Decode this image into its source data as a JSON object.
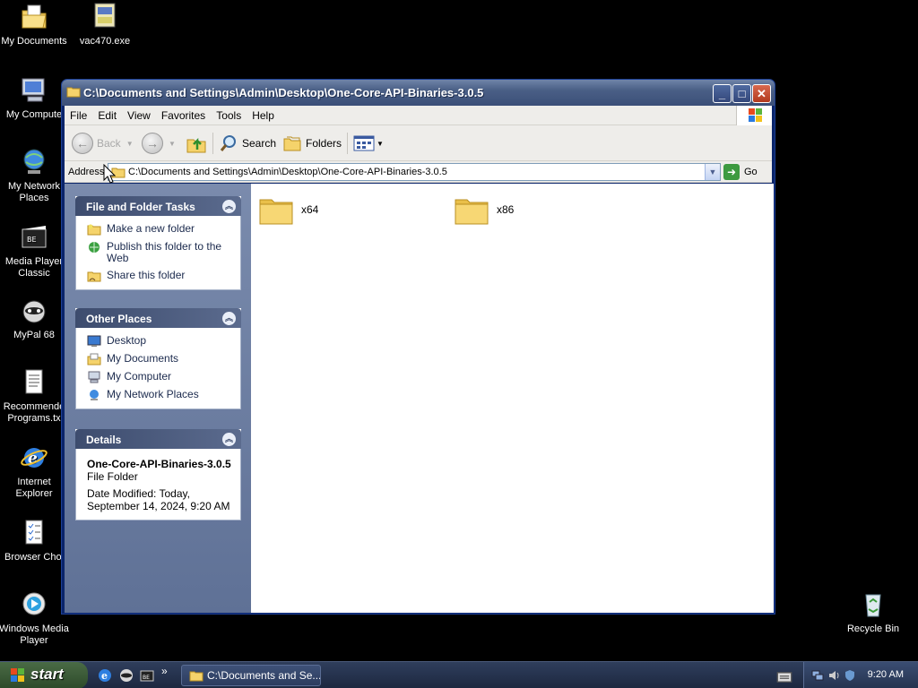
{
  "desktop": {
    "icons": [
      {
        "label": "My Documents",
        "icon": "my-documents-icon"
      },
      {
        "label": "vac470.exe",
        "icon": "installer-icon"
      },
      {
        "label": "My Compute",
        "icon": "my-computer-icon"
      },
      {
        "label": "My Network Places",
        "icon": "network-places-icon"
      },
      {
        "label": "Media Player Classic",
        "icon": "media-player-classic-icon"
      },
      {
        "label": "MyPal 68",
        "icon": "mypal-icon"
      },
      {
        "label": "Recommende Programs.tx",
        "icon": "text-file-icon"
      },
      {
        "label": "Internet Explorer",
        "icon": "internet-explorer-icon"
      },
      {
        "label": "Browser Choi",
        "icon": "browser-choice-icon"
      },
      {
        "label": "Windows Media Player",
        "icon": "windows-media-player-icon"
      },
      {
        "label": "Recycle Bin",
        "icon": "recycle-bin-icon"
      }
    ]
  },
  "window": {
    "title": "C:\\Documents and Settings\\Admin\\Desktop\\One-Core-API-Binaries-3.0.5",
    "menu": [
      "File",
      "Edit",
      "View",
      "Favorites",
      "Tools",
      "Help"
    ],
    "toolbar": {
      "back_label": "Back",
      "search_label": "Search",
      "folders_label": "Folders"
    },
    "address": {
      "label": "Address",
      "value": "C:\\Documents and Settings\\Admin\\Desktop\\One-Core-API-Binaries-3.0.5",
      "go_label": "Go"
    },
    "task_pane": {
      "file_tasks": {
        "title": "File and Folder Tasks",
        "links": [
          "Make a new folder",
          "Publish this folder to the Web",
          "Share this folder"
        ]
      },
      "other_places": {
        "title": "Other Places",
        "links": [
          "Desktop",
          "My Documents",
          "My Computer",
          "My Network Places"
        ]
      },
      "details": {
        "title": "Details",
        "name": "One-Core-API-Binaries-3.0.5",
        "type": "File Folder",
        "modified_line1": "Date Modified: Today,",
        "modified_line2": "September 14, 2024, 9:20 AM"
      }
    },
    "folders": [
      {
        "name": "x64"
      },
      {
        "name": "x86"
      }
    ]
  },
  "taskbar": {
    "start_label": "start",
    "task_item": "C:\\Documents and Se...",
    "clock": "9:20 AM"
  },
  "colors": {
    "folder": "#f5d36b",
    "titlebar": "#4a5f86",
    "taskpane": "#6d7ea2"
  }
}
